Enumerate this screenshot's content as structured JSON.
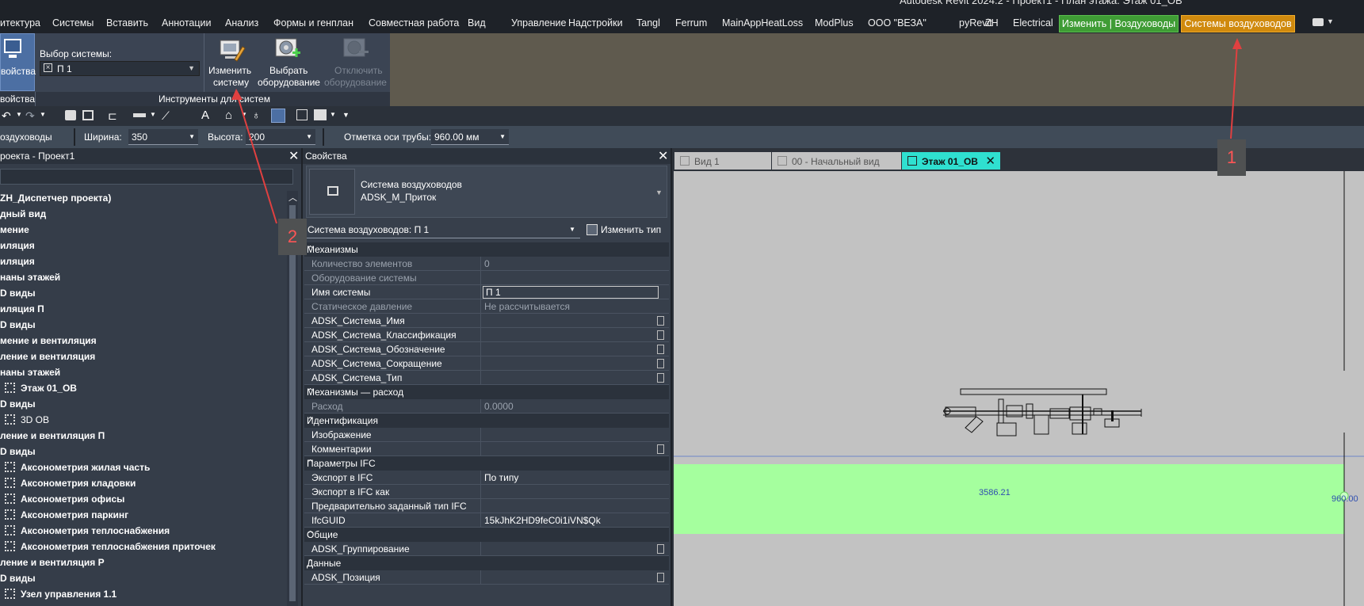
{
  "title_bar": {
    "text": "Autodesk Revit 2024.2 - Проект1 - План этажа: Этаж 01_ОВ"
  },
  "menu": {
    "items": [
      "итектура",
      "Системы",
      "Вставить",
      "Аннотации",
      "Анализ",
      "Формы и генплан",
      "Совместная работа",
      "Вид",
      "Управление",
      "Надстройки",
      "Tangl",
      "Ferrum",
      "MainAppHeatLoss",
      "ModPlus",
      "ООО \"ВЕЗА\"",
      "pyRevit",
      "ZH",
      "Electrical"
    ],
    "context_modify": "Изменить | Воздуховоды",
    "context_systems": "Системы воздуховодов"
  },
  "ribbon": {
    "properties_label": "войства",
    "system_select_label": "Выбор системы:",
    "system_select_value": "П 1",
    "edit_system_label_1": "Изменить",
    "edit_system_label_2": "систему",
    "select_equipment_label_1": "Выбрать",
    "select_equipment_label_2": "оборудование",
    "disconnect_equipment_label_1": "Отключить",
    "disconnect_equipment_label_2": "оборудование",
    "panel_properties_title": "войства",
    "panel_tools_title": "Инструменты для систем"
  },
  "options_bar": {
    "category": "оздуховоды",
    "width_label": "Ширина:",
    "width_value": "350",
    "height_label": "Высота:",
    "height_value": "200",
    "elevation_label": "Отметка оси трубы:",
    "elevation_value": "960.00 мм"
  },
  "project_browser": {
    "title": "роекта - Проект1",
    "items": [
      {
        "text": "ZH_Диспетчер проекта)",
        "bold": true,
        "box": false,
        "indent": 0
      },
      {
        "text": "дный вид",
        "bold": true,
        "box": false,
        "indent": 0
      },
      {
        "text": "мение",
        "bold": true,
        "box": false,
        "indent": 0
      },
      {
        "text": "иляция",
        "bold": true,
        "box": false,
        "indent": 0
      },
      {
        "text": "иляция",
        "bold": true,
        "box": false,
        "indent": 0
      },
      {
        "text": "наны этажей",
        "bold": true,
        "box": false,
        "indent": 0
      },
      {
        "text": "D виды",
        "bold": true,
        "box": false,
        "indent": 0
      },
      {
        "text": "иляция П",
        "bold": true,
        "box": false,
        "indent": 0
      },
      {
        "text": "D виды",
        "bold": true,
        "box": false,
        "indent": 0
      },
      {
        "text": "мение и вентиляция",
        "bold": true,
        "box": false,
        "indent": 0
      },
      {
        "text": "ление и вентиляция",
        "bold": true,
        "box": false,
        "indent": 0
      },
      {
        "text": "наны этажей",
        "bold": true,
        "box": false,
        "indent": 0
      },
      {
        "text": "Этаж 01_ОВ",
        "bold": true,
        "box": true,
        "indent": 1
      },
      {
        "text": "D виды",
        "bold": true,
        "box": false,
        "indent": 0
      },
      {
        "text": "3D ОВ",
        "bold": false,
        "box": true,
        "indent": 1
      },
      {
        "text": "ление и вентиляция П",
        "bold": true,
        "box": false,
        "indent": 0
      },
      {
        "text": "D виды",
        "bold": true,
        "box": false,
        "indent": 0
      },
      {
        "text": "Аксонометрия жилая часть",
        "bold": true,
        "box": true,
        "indent": 1
      },
      {
        "text": "Аксонометрия кладовки",
        "bold": true,
        "box": true,
        "indent": 1
      },
      {
        "text": "Аксонометрия офисы",
        "bold": true,
        "box": true,
        "indent": 1
      },
      {
        "text": "Аксонометрия паркинг",
        "bold": true,
        "box": true,
        "indent": 1
      },
      {
        "text": "Аксонометрия теплоснабжения",
        "bold": true,
        "box": true,
        "indent": 1
      },
      {
        "text": "Аксонометрия теплоснабжения приточек",
        "bold": true,
        "box": true,
        "indent": 1
      },
      {
        "text": "ление и вентиляция Р",
        "bold": true,
        "box": false,
        "indent": 0
      },
      {
        "text": "D виды",
        "bold": true,
        "box": false,
        "indent": 0
      },
      {
        "text": "Узел управления 1.1",
        "bold": true,
        "box": true,
        "indent": 1
      }
    ]
  },
  "properties": {
    "title": "Свойства",
    "type_name_1": "Система воздуховодов",
    "type_name_2": "ADSK_М_Приток",
    "instance_selector": "Система воздуховодов: П 1",
    "edit_type_label": "Изменить тип",
    "groups": [
      {
        "title": "Механизмы",
        "rows": [
          {
            "name": "Количество элементов",
            "value": "0",
            "greyed": true,
            "kind": "text"
          },
          {
            "name": "Оборудование системы",
            "value": "",
            "greyed": true,
            "kind": "text"
          },
          {
            "name": "Имя системы",
            "value": "П 1",
            "greyed": false,
            "kind": "input"
          },
          {
            "name": "Статическое давление",
            "value": "Не рассчитывается",
            "greyed": true,
            "kind": "text"
          },
          {
            "name": "ADSK_Система_Имя",
            "value": "",
            "greyed": false,
            "kind": "box"
          },
          {
            "name": "ADSK_Система_Классификация",
            "value": "",
            "greyed": false,
            "kind": "box"
          },
          {
            "name": "ADSK_Система_Обозначение",
            "value": "",
            "greyed": false,
            "kind": "box"
          },
          {
            "name": "ADSK_Система_Сокращение",
            "value": "",
            "greyed": false,
            "kind": "box"
          },
          {
            "name": "ADSK_Система_Тип",
            "value": "",
            "greyed": false,
            "kind": "box"
          }
        ]
      },
      {
        "title": "Механизмы — расход",
        "rows": [
          {
            "name": "Расход",
            "value": "0.0000",
            "greyed": true,
            "kind": "text"
          }
        ]
      },
      {
        "title": "Идентификация",
        "rows": [
          {
            "name": "Изображение",
            "value": "",
            "greyed": false,
            "kind": "text"
          },
          {
            "name": "Комментарии",
            "value": "",
            "greyed": false,
            "kind": "box"
          }
        ]
      },
      {
        "title": "Параметры IFC",
        "rows": [
          {
            "name": "Экспорт в IFC",
            "value": "По типу",
            "greyed": false,
            "kind": "text"
          },
          {
            "name": "Экспорт в IFC как",
            "value": "",
            "greyed": false,
            "kind": "text"
          },
          {
            "name": "Предварительно заданный тип IFC",
            "value": "",
            "greyed": false,
            "kind": "text"
          },
          {
            "name": "IfcGUID",
            "value": "15kJhK2HD9feC0i1iVN$Qk",
            "greyed": false,
            "kind": "text"
          }
        ]
      },
      {
        "title": "Общие",
        "rows": [
          {
            "name": "ADSK_Группирование",
            "value": "",
            "greyed": false,
            "kind": "box"
          }
        ]
      },
      {
        "title": "Данные",
        "rows": [
          {
            "name": "ADSK_Позиция",
            "value": "",
            "greyed": false,
            "kind": "box"
          }
        ]
      }
    ]
  },
  "view_tabs": [
    {
      "label": "Вид 1",
      "active": false
    },
    {
      "label": "00 - Начальный вид",
      "active": false
    },
    {
      "label": "Этаж 01_ОВ",
      "active": true
    }
  ],
  "canvas": {
    "dimension_1": "3586.21",
    "dimension_2": "960.00"
  },
  "annotations": {
    "marker_1": "1",
    "marker_2": "2"
  }
}
